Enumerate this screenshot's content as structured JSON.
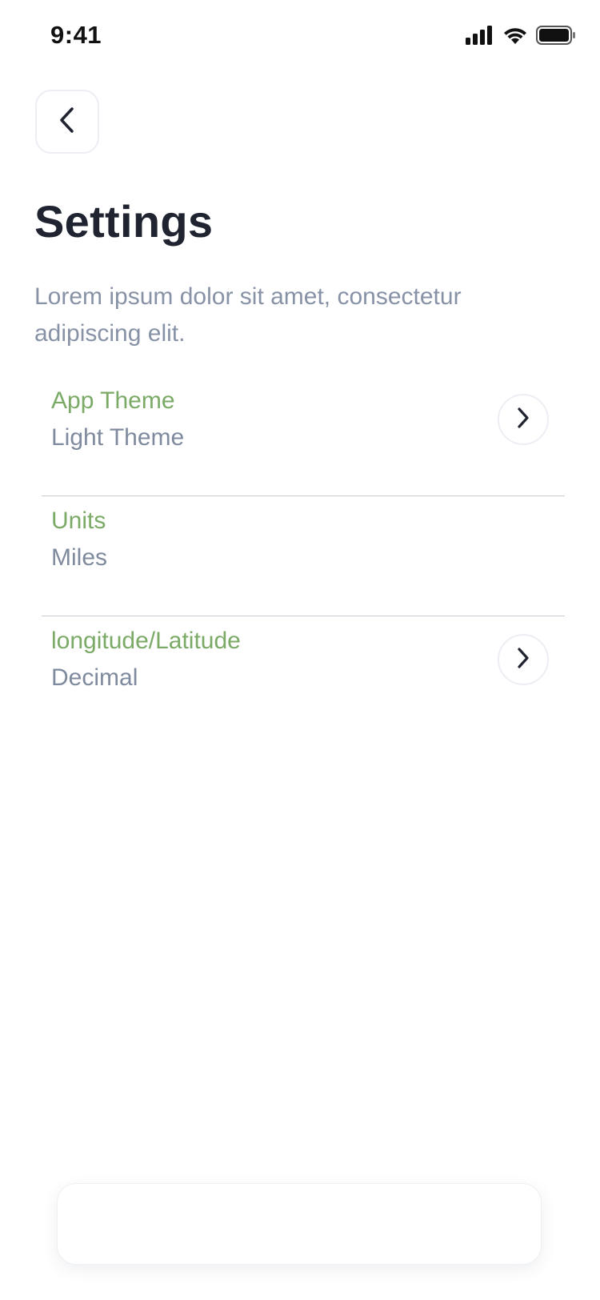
{
  "status_bar": {
    "time": "9:41",
    "icons": [
      "cellular-signal-icon",
      "wifi-icon",
      "battery-icon"
    ]
  },
  "header": {
    "back_icon": "chevron-left-icon",
    "title": "Settings",
    "description": "Lorem ipsum dolor sit amet, consectetur adipiscing elit."
  },
  "settings": {
    "items": [
      {
        "label": "App Theme",
        "value": "Light Theme",
        "has_chevron": true
      },
      {
        "label": "Units",
        "value": "Miles",
        "has_chevron": false
      },
      {
        "label": "longitude/Latitude",
        "value": "Decimal",
        "has_chevron": true
      }
    ]
  },
  "colors": {
    "accent_label": "#7aaa66",
    "muted_text": "#8792a6",
    "title_text": "#1f2430",
    "divider": "#c9ccd2"
  }
}
